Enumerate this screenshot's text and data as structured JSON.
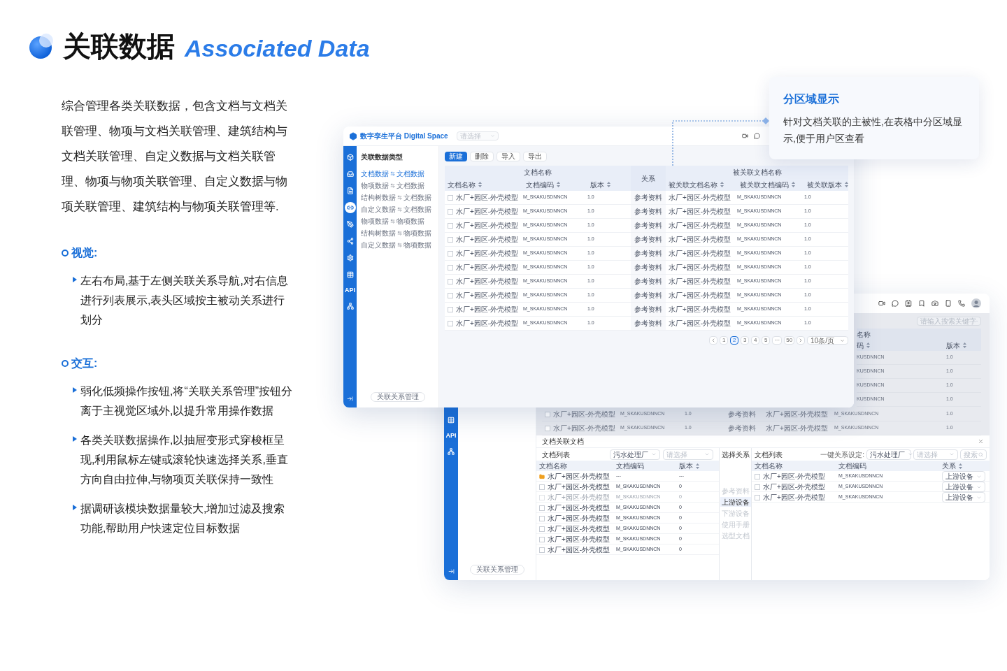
{
  "header": {
    "title": "关联数据",
    "subtitle": "Associated Data"
  },
  "intro": "综合管理各类关联数据，包含文档与文档关联管理、物项与文档关联管理、建筑结构与文档关联管理、自定义数据与文档关联管理、物项与物项关联管理、自定义数据与物项关联管理、建筑结构与物项关联管理等.",
  "sections": [
    {
      "heading": "视觉:",
      "items": [
        "左右布局,基于左侧关联关系导航,对右信息进行列表展示,表头区域按主被动关系进行划分"
      ]
    },
    {
      "heading": "交互:",
      "items": [
        "弱化低频操作按钮,将“关联关系管理”按钮分离于主视觉区域外,以提升常用操作数据",
        "各类关联数据操作,以抽屉变形式穿梭框呈现,利用鼠标左键或滚轮快速选择关系,垂直方向自由拉伸,与物项页关联保持一致性",
        "据调研该模块数据量较大,增加过滤及搜索功能,帮助用户快速定位目标数据"
      ]
    }
  ],
  "callout": {
    "title": "分区域显示",
    "text": "针对文档关联的主被性,在表格中分区域显示,便于用户区查看"
  },
  "main_window": {
    "brand": "数字孪生平台 Digital Space",
    "project_select": {
      "placeholder": "请选择"
    },
    "rail": [
      {
        "selected": false
      },
      {
        "selected": false
      },
      {
        "selected": false
      },
      {
        "selected": true
      },
      {
        "selected": false
      },
      {
        "selected": false
      },
      {
        "selected": false
      },
      {
        "selected": false
      },
      {
        "label": "API",
        "selected": false
      },
      {
        "selected": false
      }
    ],
    "nav_title": "关联数据类型",
    "nav_items": [
      {
        "source": "文档数据",
        "target": "文档数据",
        "selected": true
      },
      {
        "source": "物项数据",
        "target": "文档数据",
        "selected": false
      },
      {
        "source": "结构树数据",
        "target": "文档数据",
        "selected": false
      },
      {
        "source": "自定义数据",
        "target": "文档数据",
        "selected": false
      },
      {
        "source": "物项数据",
        "target": "物项数据",
        "selected": false
      },
      {
        "source": "结构树数据",
        "target": "物项数据",
        "selected": false
      },
      {
        "source": "自定义数据",
        "target": "物项数据",
        "selected": false
      }
    ],
    "manage_button": "关联关系管理",
    "toolbar": [
      {
        "label": "新建",
        "primary": true
      },
      {
        "label": "删除",
        "primary": false
      },
      {
        "label": "导入",
        "primary": false
      },
      {
        "label": "导出",
        "primary": false
      }
    ],
    "group_headers": {
      "source": "文档名称",
      "relation": "关系",
      "target": "被关联文档名称"
    },
    "columns": [
      {
        "label": "文档名称",
        "sortable": true
      },
      {
        "label": "文档编码",
        "sortable": true
      },
      {
        "label": "版本",
        "sortable": true
      },
      {
        "label": "被关联文档名称",
        "sortable": true
      },
      {
        "label": "被关联文档编码",
        "sortable": true
      },
      {
        "label": "被关联版本",
        "sortable": true
      }
    ],
    "rows": [
      {
        "checked": false,
        "name": "水厂+园区-外壳模型",
        "code": "M_SKAKUSDNNCN",
        "version": "1.0",
        "relation": "参考资料",
        "target_name": "水厂+园区-外壳模型",
        "target_code": "M_SKAKUSDNNCN",
        "target_version": "1.0"
      },
      {
        "checked": false,
        "name": "水厂+园区-外壳模型",
        "code": "M_SKAKUSDNNCN",
        "version": "1.0",
        "relation": "参考资料",
        "target_name": "水厂+园区-外壳模型",
        "target_code": "M_SKAKUSDNNCN",
        "target_version": "1.0"
      },
      {
        "checked": false,
        "name": "水厂+园区-外壳模型",
        "code": "M_SKAKUSDNNCN",
        "version": "1.0",
        "relation": "参考资料",
        "target_name": "水厂+园区-外壳模型",
        "target_code": "M_SKAKUSDNNCN",
        "target_version": "1.0"
      },
      {
        "checked": false,
        "name": "水厂+园区-外壳模型",
        "code": "M_SKAKUSDNNCN",
        "version": "1.0",
        "relation": "参考资料",
        "target_name": "水厂+园区-外壳模型",
        "target_code": "M_SKAKUSDNNCN",
        "target_version": "1.0"
      },
      {
        "checked": false,
        "name": "水厂+园区-外壳模型",
        "code": "M_SKAKUSDNNCN",
        "version": "1.0",
        "relation": "参考资料",
        "target_name": "水厂+园区-外壳模型",
        "target_code": "M_SKAKUSDNNCN",
        "target_version": "1.0"
      },
      {
        "checked": false,
        "name": "水厂+园区-外壳模型",
        "code": "M_SKAKUSDNNCN",
        "version": "1.0",
        "relation": "参考资料",
        "target_name": "水厂+园区-外壳模型",
        "target_code": "M_SKAKUSDNNCN",
        "target_version": "1.0"
      },
      {
        "checked": false,
        "name": "水厂+园区-外壳模型",
        "code": "M_SKAKUSDNNCN",
        "version": "1.0",
        "relation": "参考资料",
        "target_name": "水厂+园区-外壳模型",
        "target_code": "M_SKAKUSDNNCN",
        "target_version": "1.0"
      },
      {
        "checked": false,
        "name": "水厂+园区-外壳模型",
        "code": "M_SKAKUSDNNCN",
        "version": "1.0",
        "relation": "参考资料",
        "target_name": "水厂+园区-外壳模型",
        "target_code": "M_SKAKUSDNNCN",
        "target_version": "1.0"
      },
      {
        "checked": false,
        "name": "水厂+园区-外壳模型",
        "code": "M_SKAKUSDNNCN",
        "version": "1.0",
        "relation": "参考资料",
        "target_name": "水厂+园区-外壳模型",
        "target_code": "M_SKAKUSDNNCN",
        "target_version": "1.0"
      },
      {
        "checked": false,
        "name": "水厂+园区-外壳模型",
        "code": "M_SKAKUSDNNCN",
        "version": "1.0",
        "relation": "参考资料",
        "target_name": "水厂+园区-外壳模型",
        "target_code": "M_SKAKUSDNNCN",
        "target_version": "1.0"
      }
    ],
    "pagination": {
      "pages": [
        {
          "label": "1",
          "selected": false
        },
        {
          "label": "2",
          "selected": true
        },
        {
          "label": "3",
          "selected": false
        },
        {
          "label": "4",
          "selected": false
        },
        {
          "label": "5",
          "selected": false
        },
        {
          "label": "···",
          "selected": false
        },
        {
          "label": "50",
          "selected": false
        }
      ],
      "page_size": "10条/页"
    }
  },
  "back_window": {
    "search": {
      "placeholder": "请输入搜索关键字"
    },
    "strip_headers": {
      "group": "名称",
      "columns": [
        {
          "label": "码",
          "sortable": true
        },
        {
          "label": "版本",
          "sortable": true
        }
      ]
    },
    "strip_rows": [
      {
        "code": "KUSDNNCN",
        "version": "1.0"
      },
      {
        "code": "KUSDNNCN",
        "version": "1.0"
      },
      {
        "code": "KUSDNNCN",
        "version": "1.0"
      },
      {
        "code": "KUSDNNCN",
        "version": "1.0"
      }
    ],
    "rows": [
      {
        "checked": false,
        "name": "水厂+园区-外壳模型",
        "code": "M_SKAKUSDNNCN",
        "version": "1.0",
        "relation": "参考资料",
        "target_name": "水厂+园区-外壳模型",
        "target_code": "M_SKAKUSDNNCN",
        "target_version": "1.0"
      },
      {
        "checked": false,
        "name": "水厂+园区-外壳模型",
        "code": "M_SKAKUSDNNCN",
        "version": "1.0",
        "relation": "参考资料",
        "target_name": "水厂+园区-外壳模型",
        "target_code": "M_SKAKUSDNNCN",
        "target_version": "1.0"
      }
    ],
    "rail": [
      {
        "selected": false
      },
      {
        "label": "API",
        "selected": false
      },
      {
        "selected": false
      }
    ],
    "manage_button": "关联关系管理",
    "drawer": {
      "title": "文档关联文档",
      "left": {
        "title": "文档列表",
        "filters": [
          {
            "value": "污水处理厂"
          },
          {
            "placeholder": "请选择"
          }
        ],
        "columns": [
          {
            "label": "文档名称",
            "sortable": false
          },
          {
            "label": "文档编码",
            "sortable": false
          },
          {
            "label": "版本",
            "sortable": true
          }
        ],
        "rows": [
          {
            "kind": "folder",
            "name": "水厂+园区-外壳模型",
            "code": "---",
            "version": "---",
            "disabled": false
          },
          {
            "kind": "file",
            "checked": false,
            "name": "水厂+园区-外壳模型",
            "code": "M_SKAKUSDNNCN",
            "version": "0",
            "disabled": false
          },
          {
            "kind": "file",
            "checked": false,
            "name": "水厂+园区-外壳模型",
            "code": "M_SKAKUSDNNCN",
            "version": "0",
            "disabled": true
          },
          {
            "kind": "file",
            "checked": false,
            "name": "水厂+园区-外壳模型",
            "code": "M_SKAKUSDNNCN",
            "version": "0",
            "disabled": false
          },
          {
            "kind": "file",
            "checked": false,
            "name": "水厂+园区-外壳模型",
            "code": "M_SKAKUSDNNCN",
            "version": "0",
            "disabled": false
          },
          {
            "kind": "file",
            "checked": false,
            "name": "水厂+园区-外壳模型",
            "code": "M_SKAKUSDNNCN",
            "version": "0",
            "disabled": false
          },
          {
            "kind": "file",
            "checked": false,
            "name": "水厂+园区-外壳模型",
            "code": "M_SKAKUSDNNCN",
            "version": "0",
            "disabled": false
          },
          {
            "kind": "file",
            "checked": false,
            "name": "水厂+园区-外壳模型",
            "code": "M_SKAKUSDNNCN",
            "version": "0",
            "disabled": false
          }
        ]
      },
      "relations": {
        "title": "选择关系",
        "items": [
          {
            "label": "参考资料",
            "selected": false
          },
          {
            "label": "上游设备",
            "selected": true
          },
          {
            "label": "下游设备",
            "selected": false
          },
          {
            "label": "使用手册",
            "selected": false
          },
          {
            "label": "选型文档",
            "selected": false
          }
        ]
      },
      "right": {
        "title": "文档列表",
        "quick_label": "一键关系设定:",
        "filters": [
          {
            "value": "污水处理厂"
          },
          {
            "placeholder": "请选择"
          }
        ],
        "search": {
          "placeholder": "搜索"
        },
        "columns": [
          {
            "label": "文档名称",
            "sortable": false
          },
          {
            "label": "文档编码",
            "sortable": false
          },
          {
            "label": "关系",
            "sortable": true
          }
        ],
        "rows": [
          {
            "checked": false,
            "name": "水厂+园区-外壳模型",
            "code": "M_SKAKUSDNNCN",
            "relation": "上游设备"
          },
          {
            "checked": false,
            "name": "水厂+园区-外壳模型",
            "code": "M_SKAKUSDNNCN",
            "relation": "上游设备"
          },
          {
            "checked": false,
            "name": "水厂+园区-外壳模型",
            "code": "M_SKAKUSDNNCN",
            "relation": "上游设备"
          }
        ]
      }
    }
  }
}
